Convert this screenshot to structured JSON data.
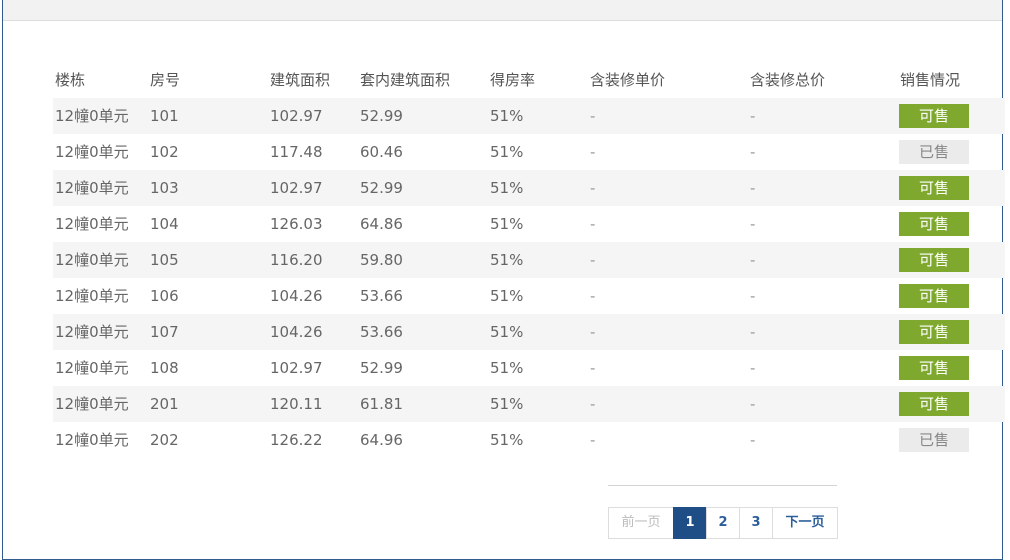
{
  "table": {
    "headers": [
      "楼栋",
      "房号",
      "建筑面积",
      "套内建筑面积",
      "得房率",
      "含装修单价",
      "含装修总价",
      "销售情况"
    ],
    "rows": [
      {
        "building": "12幢0单元",
        "room": "101",
        "area": "102.97",
        "inner_area": "52.99",
        "ratio": "51%",
        "unit_price": "-",
        "total_price": "-",
        "status": "可售",
        "available": true
      },
      {
        "building": "12幢0单元",
        "room": "102",
        "area": "117.48",
        "inner_area": "60.46",
        "ratio": "51%",
        "unit_price": "-",
        "total_price": "-",
        "status": "已售",
        "available": false
      },
      {
        "building": "12幢0单元",
        "room": "103",
        "area": "102.97",
        "inner_area": "52.99",
        "ratio": "51%",
        "unit_price": "-",
        "total_price": "-",
        "status": "可售",
        "available": true
      },
      {
        "building": "12幢0单元",
        "room": "104",
        "area": "126.03",
        "inner_area": "64.86",
        "ratio": "51%",
        "unit_price": "-",
        "total_price": "-",
        "status": "可售",
        "available": true
      },
      {
        "building": "12幢0单元",
        "room": "105",
        "area": "116.20",
        "inner_area": "59.80",
        "ratio": "51%",
        "unit_price": "-",
        "total_price": "-",
        "status": "可售",
        "available": true
      },
      {
        "building": "12幢0单元",
        "room": "106",
        "area": "104.26",
        "inner_area": "53.66",
        "ratio": "51%",
        "unit_price": "-",
        "total_price": "-",
        "status": "可售",
        "available": true
      },
      {
        "building": "12幢0单元",
        "room": "107",
        "area": "104.26",
        "inner_area": "53.66",
        "ratio": "51%",
        "unit_price": "-",
        "total_price": "-",
        "status": "可售",
        "available": true
      },
      {
        "building": "12幢0单元",
        "room": "108",
        "area": "102.97",
        "inner_area": "52.99",
        "ratio": "51%",
        "unit_price": "-",
        "total_price": "-",
        "status": "可售",
        "available": true
      },
      {
        "building": "12幢0单元",
        "room": "201",
        "area": "120.11",
        "inner_area": "61.81",
        "ratio": "51%",
        "unit_price": "-",
        "total_price": "-",
        "status": "可售",
        "available": true
      },
      {
        "building": "12幢0单元",
        "room": "202",
        "area": "126.22",
        "inner_area": "64.96",
        "ratio": "51%",
        "unit_price": "-",
        "total_price": "-",
        "status": "已售",
        "available": false
      }
    ]
  },
  "pagination": {
    "prev_label": "前一页",
    "pages": [
      "1",
      "2",
      "3"
    ],
    "current_page": "1",
    "next_label": "下一页"
  },
  "colors": {
    "available_badge": "#7fa92e",
    "sold_badge": "#ebebeb",
    "active_page": "#1f4e87",
    "frame_border": "#2f5b8f"
  }
}
